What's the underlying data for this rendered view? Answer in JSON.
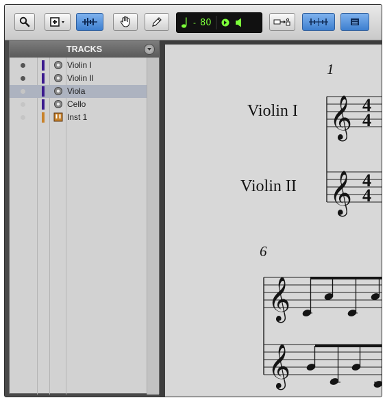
{
  "toolbar": {
    "tools": [
      {
        "name": "zoom-tool",
        "icon": "magnifier-icon"
      },
      {
        "name": "selection-tool",
        "icon": "select-plus-icon"
      },
      {
        "name": "trim-tool",
        "icon": "waveform-icon",
        "active": true
      },
      {
        "name": "grabber-tool",
        "icon": "hand-icon"
      },
      {
        "name": "pencil-tool",
        "icon": "pencil-icon"
      }
    ],
    "counter": {
      "note_icon": "quarter-note-icon",
      "tempo": "80",
      "metronome_icon": "metronome-icon",
      "speaker_icon": "speaker-icon"
    },
    "link_icon": "midi-link-icon",
    "grid_icon": "grid-icon",
    "menu_icon": "list-icon"
  },
  "tracks": {
    "title": "TRACKS",
    "items": [
      {
        "name": "Violin I",
        "active": true,
        "selected": false,
        "type": "audio"
      },
      {
        "name": "Violin II",
        "active": true,
        "selected": false,
        "type": "audio"
      },
      {
        "name": "Viola",
        "active": false,
        "selected": true,
        "type": "audio"
      },
      {
        "name": "Cello",
        "active": false,
        "selected": false,
        "type": "audio"
      },
      {
        "name": "Inst 1",
        "active": false,
        "selected": false,
        "type": "instrument"
      }
    ]
  },
  "score": {
    "measure_1": "1",
    "measure_6": "6",
    "staff_labels": [
      "Violin I",
      "Violin II"
    ],
    "time_signature": {
      "top": "4",
      "bottom": "4"
    }
  },
  "colors": {
    "track_color": "#3b1a8e",
    "instrument_color": "#c8822a",
    "counter_text": "#7cff3a",
    "active_tool": "#3d7fcf"
  }
}
